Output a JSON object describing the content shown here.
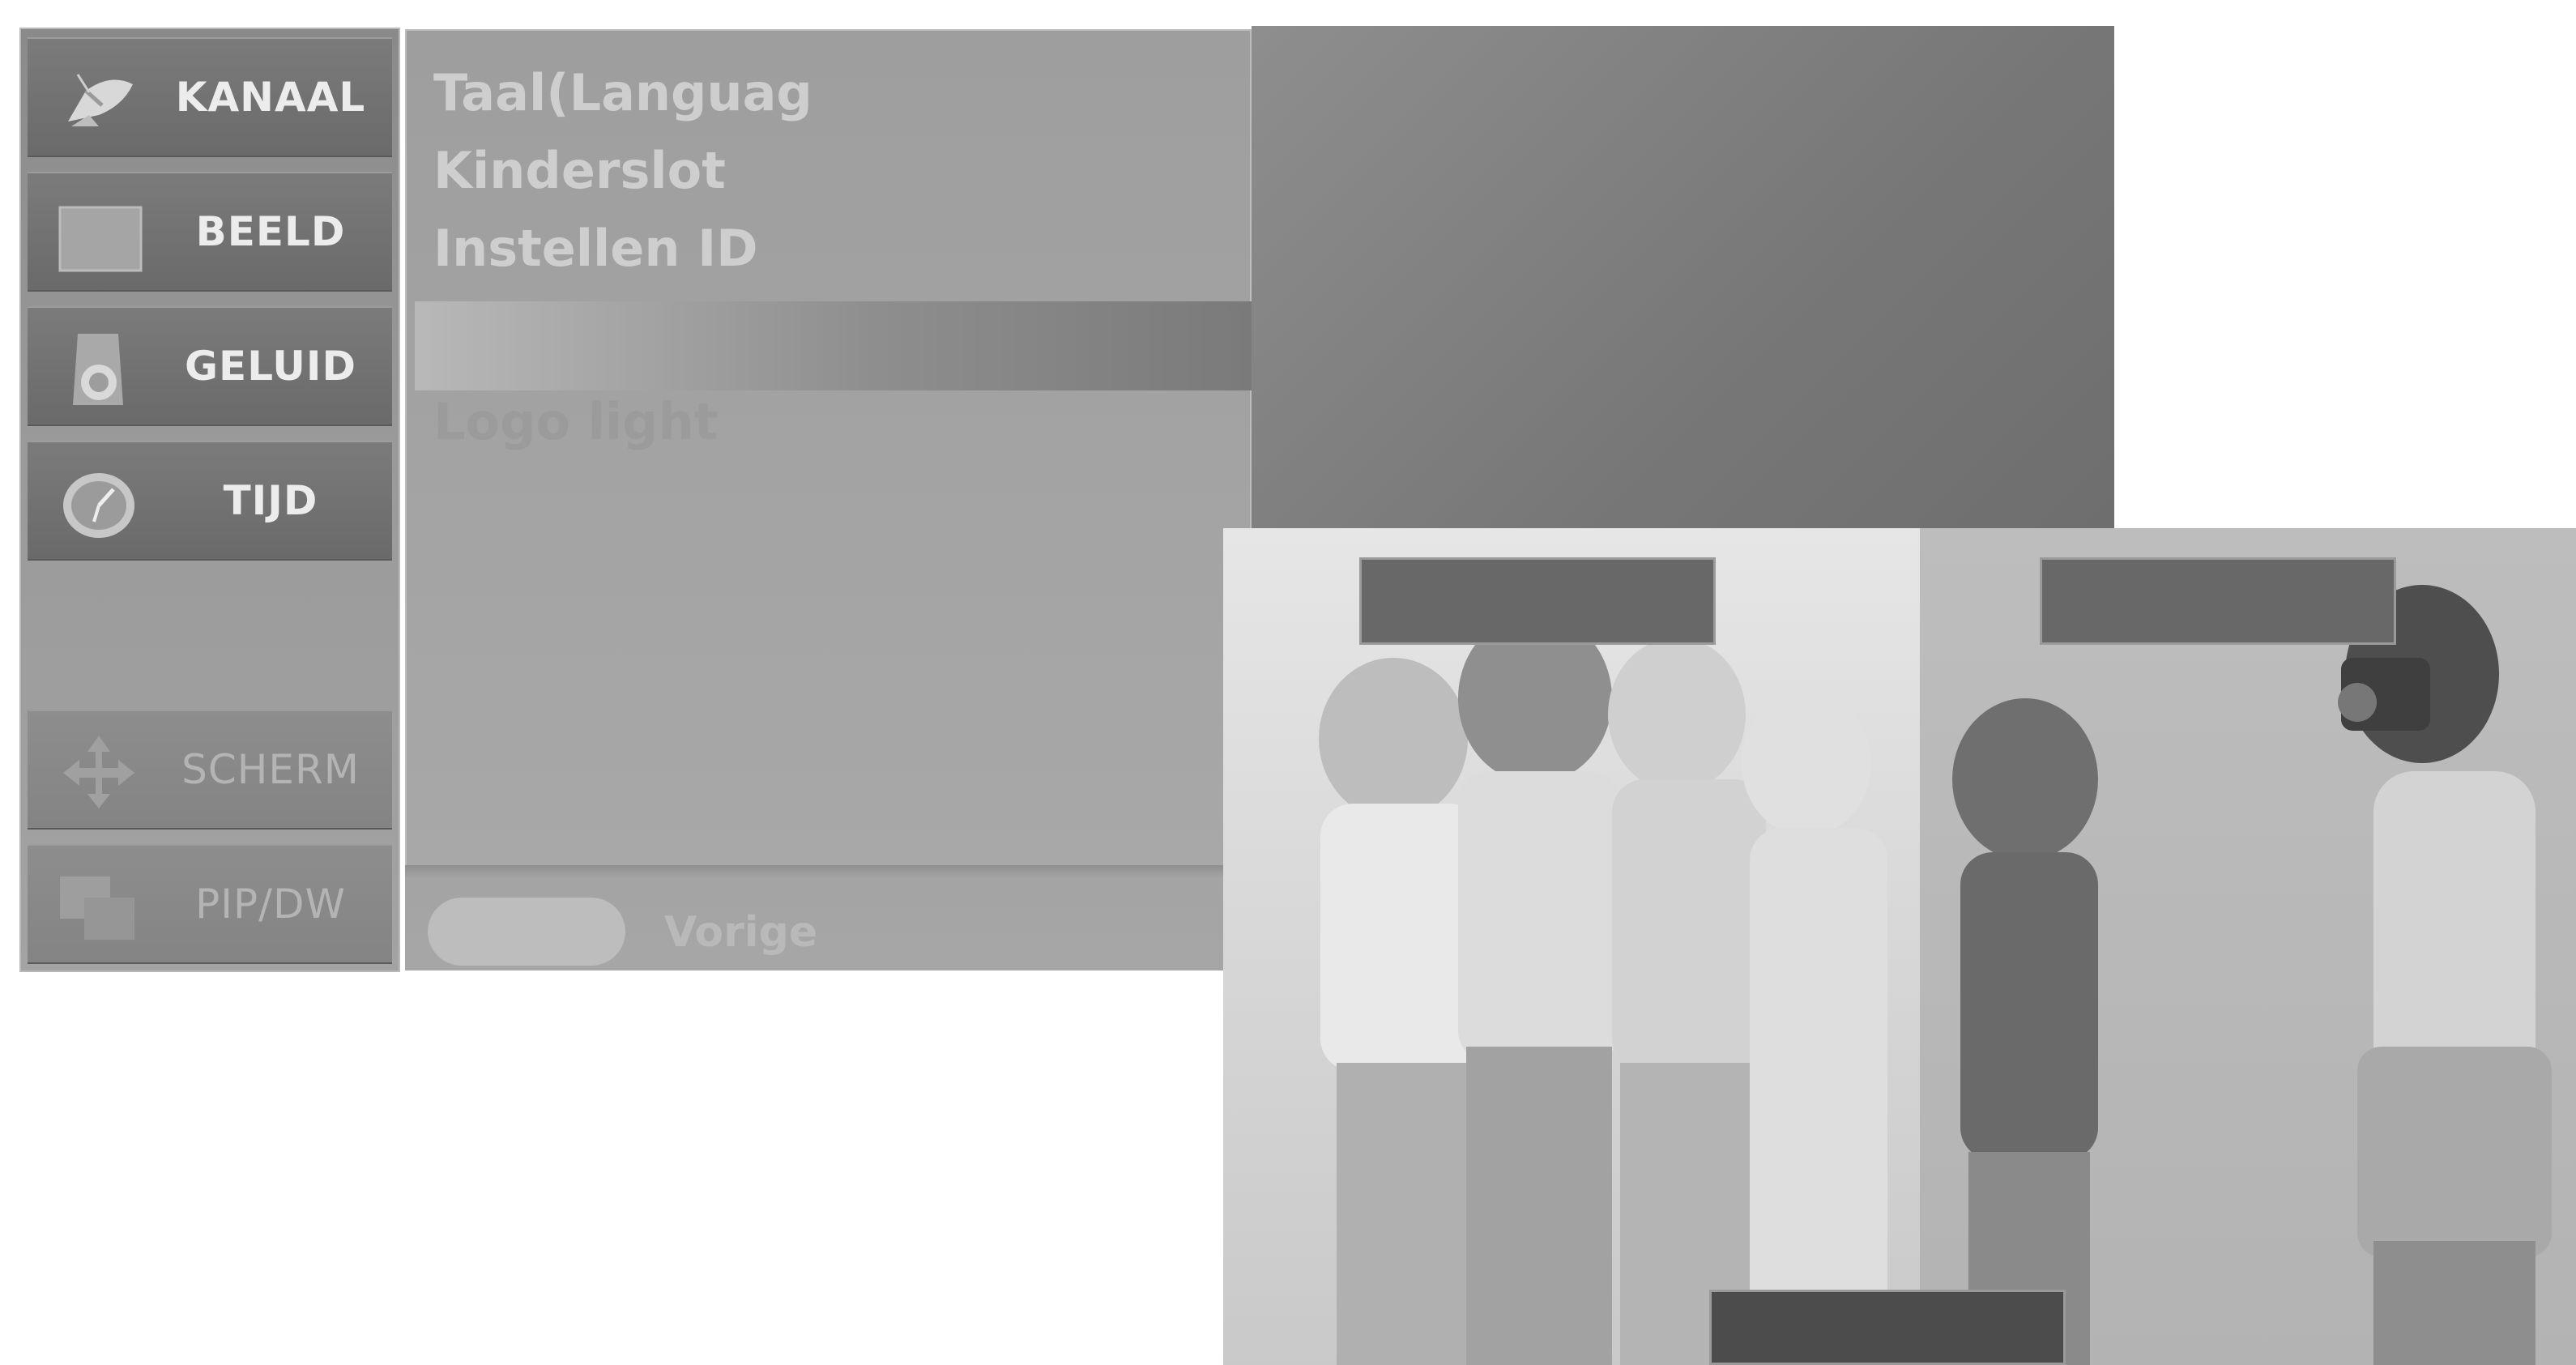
{
  "menu": {
    "categories": [
      {
        "label": "KANAAL",
        "icon": "satellite-dish-icon"
      },
      {
        "label": "BEELD",
        "icon": "picture-square-icon"
      },
      {
        "label": "GELUID",
        "icon": "speaker-icon"
      },
      {
        "label": "TIJD",
        "icon": "clock-icon"
      },
      {
        "label": "SCHERM",
        "icon": "move-arrows-icon"
      },
      {
        "label": "PIP/DW",
        "icon": "pip-windows-icon"
      }
    ]
  },
  "submenu": {
    "options": [
      {
        "label": "Taal(Languag"
      },
      {
        "label": "Kinderslot"
      },
      {
        "label": "Instellen ID"
      },
      {
        "label": ""
      },
      {
        "label": "Logo light"
      }
    ],
    "prev_label": "Vorige"
  },
  "colors": {
    "menu_bg": "#8a8a8a",
    "active_tile": "#6a6a6a",
    "text_light": "#ececec",
    "pip_label_bar": "#686868"
  }
}
